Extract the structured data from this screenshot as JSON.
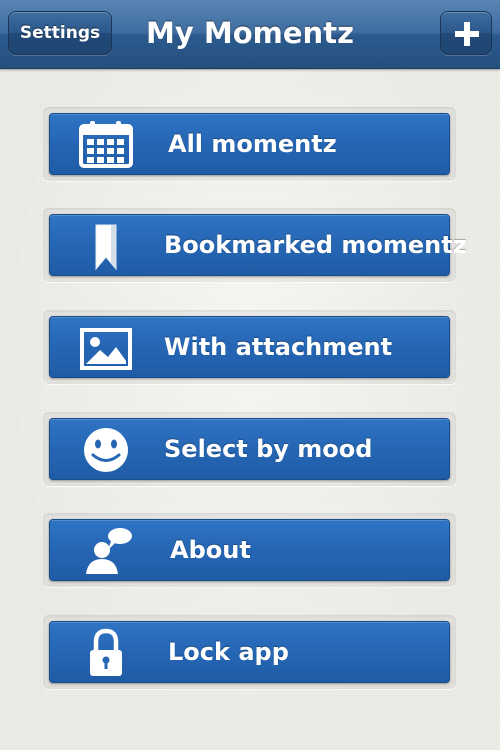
{
  "navbar": {
    "title": "My Momentz",
    "settings_label": "Settings",
    "add_icon": "plus-icon"
  },
  "menu": {
    "items": [
      {
        "label": "All momentz",
        "icon": "calendar-icon"
      },
      {
        "label": "Bookmarked momentz",
        "icon": "bookmark-icon"
      },
      {
        "label": "With attachment",
        "icon": "image-icon"
      },
      {
        "label": "Select by mood",
        "icon": "smiley-face-icon"
      },
      {
        "label": "About",
        "icon": "person-speech-bubble-icon"
      },
      {
        "label": "Lock app",
        "icon": "padlock-icon"
      }
    ]
  },
  "colors": {
    "nav_bar": "#2c5a8e",
    "button_blue": "#2566b4",
    "background": "#ecebe6"
  }
}
